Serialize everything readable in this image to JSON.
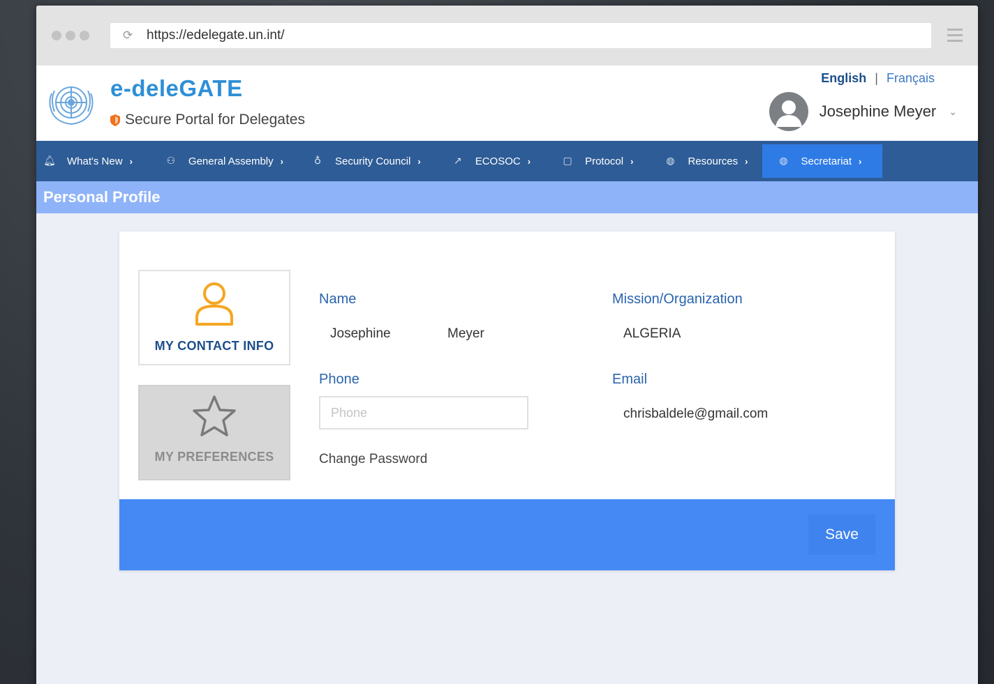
{
  "browser": {
    "url": "https://edelegate.un.int/"
  },
  "header": {
    "brand": "e-deleGATE",
    "tagline": "Secure Portal for Delegates",
    "lang_en": "English",
    "lang_sep": "|",
    "lang_fr": "Français",
    "user_name": "Josephine Meyer"
  },
  "nav": {
    "items": [
      {
        "label": "What's New",
        "icon": "bell-icon"
      },
      {
        "label": "General Assembly",
        "icon": "people-icon"
      },
      {
        "label": "Security Council",
        "icon": "award-icon"
      },
      {
        "label": "ECOSOC",
        "icon": "trend-icon"
      },
      {
        "label": "Protocol",
        "icon": "clipboard-icon"
      },
      {
        "label": "Resources",
        "icon": "globe-icon"
      },
      {
        "label": "Secretariat",
        "icon": "globe-icon"
      }
    ],
    "active_index": 6
  },
  "page": {
    "title": "Personal Profile"
  },
  "profile": {
    "tiles": {
      "contact": "MY CONTACT INFO",
      "preferences": "MY PREFERENCES"
    },
    "name_label": "Name",
    "first_name": "Josephine",
    "last_name": "Meyer",
    "mission_label": "Mission/Organization",
    "mission_value": "ALGERIA",
    "phone_label": "Phone",
    "phone_value": "",
    "phone_placeholder": "Phone",
    "email_label": "Email",
    "email_value": "chrisbaldele@gmail.com",
    "change_password": "Change Password",
    "save_label": "Save"
  },
  "colors": {
    "brand_blue": "#2e8fd6",
    "nav_bg": "#2e5c96",
    "nav_active": "#2f7be6",
    "subbar": "#8eb3f8",
    "footer": "#4489f4",
    "contact_icon": "#f5a623"
  }
}
